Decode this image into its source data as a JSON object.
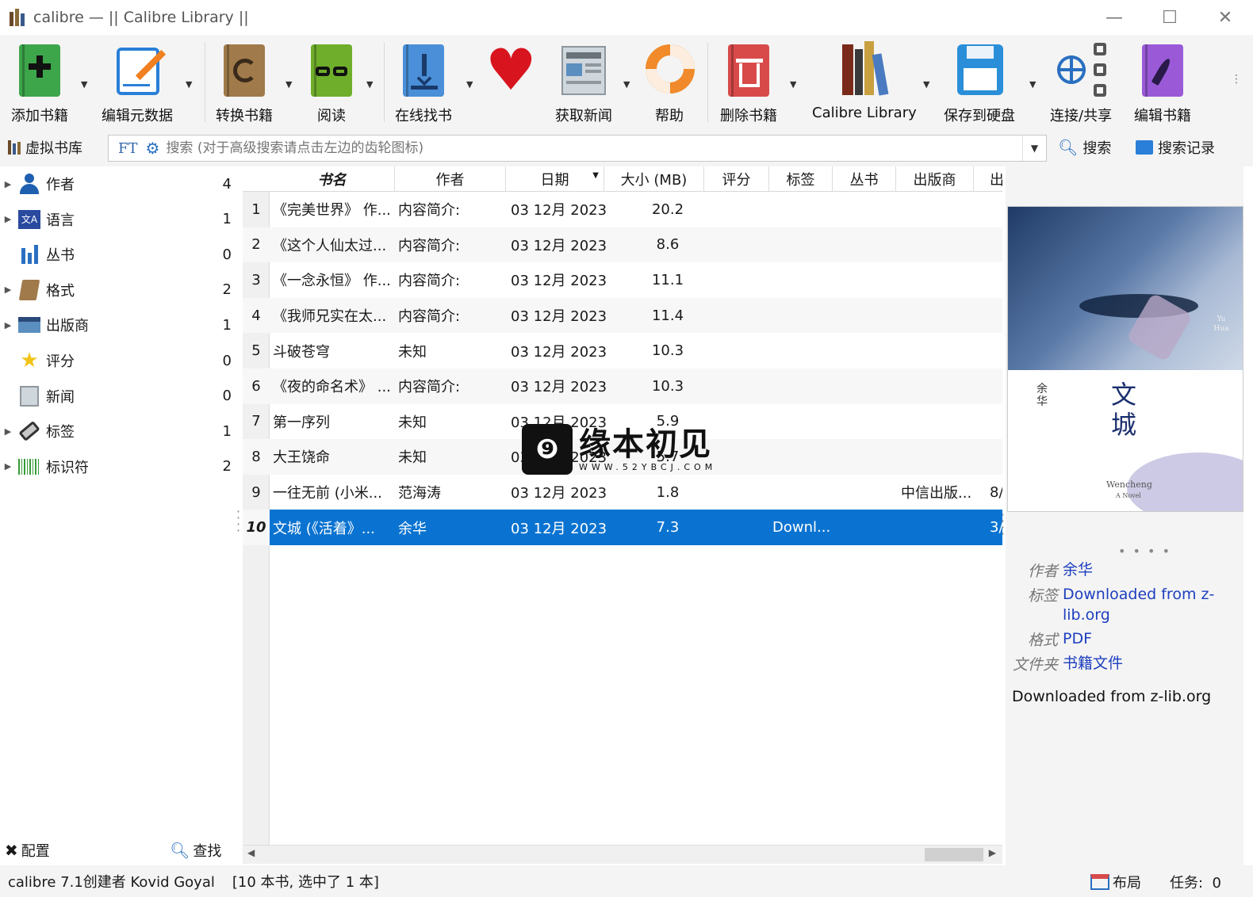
{
  "window": {
    "title": "calibre — || Calibre Library ||",
    "controls": [
      "—",
      "☐",
      "✕"
    ]
  },
  "toolbar": {
    "items": [
      {
        "label": "添加书籍",
        "icon": "add-book-icon"
      },
      {
        "label": "编辑元数据",
        "icon": "edit-metadata-icon"
      },
      {
        "label": "转换书籍",
        "icon": "convert-book-icon"
      },
      {
        "label": "阅读",
        "icon": "read-book-icon"
      },
      {
        "label": "在线找书",
        "icon": "get-books-icon"
      },
      {
        "label": "",
        "icon": "donate-heart-icon"
      },
      {
        "label": "获取新闻",
        "icon": "fetch-news-icon"
      },
      {
        "label": "帮助",
        "icon": "help-lifebuoy-icon"
      },
      {
        "label": "删除书籍",
        "icon": "remove-book-icon"
      },
      {
        "label": "Calibre Library",
        "icon": "library-icon"
      },
      {
        "label": "保存到硬盘",
        "icon": "save-disk-icon"
      },
      {
        "label": "连接/共享",
        "icon": "connect-share-icon"
      },
      {
        "label": "编辑书籍",
        "icon": "edit-book-icon"
      }
    ]
  },
  "searchbar": {
    "virtual_library": "虚拟书库",
    "placeholder": "搜索 (对于高级搜索请点击左边的齿轮图标)",
    "ft": "FT",
    "search_button": "搜索",
    "saved_search_button": "搜索记录"
  },
  "tag_browser": {
    "items": [
      {
        "label": "作者",
        "count": "4",
        "expandable": true
      },
      {
        "label": "语言",
        "count": "1",
        "expandable": true
      },
      {
        "label": "丛书",
        "count": "0",
        "expandable": false
      },
      {
        "label": "格式",
        "count": "2",
        "expandable": true
      },
      {
        "label": "出版商",
        "count": "1",
        "expandable": true
      },
      {
        "label": "评分",
        "count": "0",
        "expandable": false
      },
      {
        "label": "新闻",
        "count": "0",
        "expandable": false
      },
      {
        "label": "标签",
        "count": "1",
        "expandable": true
      },
      {
        "label": "标识符",
        "count": "2",
        "expandable": true
      }
    ],
    "configure": "配置",
    "find": "查找"
  },
  "book_table": {
    "columns": [
      "书名",
      "作者",
      "日期",
      "大小 (MB)",
      "评分",
      "标签",
      "丛书",
      "出版商",
      "出"
    ],
    "rows": [
      {
        "num": "1",
        "title": "《完美世界》 作...",
        "author": "内容简介:",
        "date": "03 12月 2023",
        "size": "20.2",
        "tags": "",
        "publisher": "",
        "extra": ""
      },
      {
        "num": "2",
        "title": "《这个人仙太过...",
        "author": "内容简介:",
        "date": "03 12月 2023",
        "size": "8.6",
        "tags": "",
        "publisher": "",
        "extra": ""
      },
      {
        "num": "3",
        "title": "《一念永恒》 作...",
        "author": "内容简介:",
        "date": "03 12月 2023",
        "size": "11.1",
        "tags": "",
        "publisher": "",
        "extra": ""
      },
      {
        "num": "4",
        "title": "《我师兄实在太...",
        "author": "内容简介:",
        "date": "03 12月 2023",
        "size": "11.4",
        "tags": "",
        "publisher": "",
        "extra": ""
      },
      {
        "num": "5",
        "title": "斗破苍穹",
        "author": "未知",
        "date": "03 12月 2023",
        "size": "10.3",
        "tags": "",
        "publisher": "",
        "extra": ""
      },
      {
        "num": "6",
        "title": "《夜的命名术》 ...",
        "author": "内容简介:",
        "date": "03 12月 2023",
        "size": "10.3",
        "tags": "",
        "publisher": "",
        "extra": ""
      },
      {
        "num": "7",
        "title": "第一序列",
        "author": "未知",
        "date": "03 12月 2023",
        "size": "5.9",
        "tags": "",
        "publisher": "",
        "extra": ""
      },
      {
        "num": "8",
        "title": "大王饶命",
        "author": "未知",
        "date": "03 12月 2023",
        "size": "5.7",
        "tags": "",
        "publisher": "",
        "extra": ""
      },
      {
        "num": "9",
        "title": "一往无前 (小米...",
        "author": "范海涛",
        "date": "03 12月 2023",
        "size": "1.8",
        "tags": "",
        "publisher": "中信出版...",
        "extra": "8/"
      },
      {
        "num": "10",
        "title": "文城 (《活着》...",
        "author": "余华",
        "date": "03 12月 2023",
        "size": "7.3",
        "tags": "Downl...",
        "publisher": "",
        "extra": "3/"
      }
    ],
    "selected_row": 9
  },
  "details": {
    "cover": {
      "title": "文城",
      "author": "余华",
      "en_title": "Wencheng",
      "en_sub": "A Novel",
      "en_author": "Yu Hua"
    },
    "fields": [
      {
        "key": "作者",
        "value": "余华"
      },
      {
        "key": "标签",
        "value": "Downloaded from z-lib.org"
      },
      {
        "key": "格式",
        "value": "PDF"
      },
      {
        "key": "文件夹",
        "value": "书籍文件"
      }
    ],
    "comment": "Downloaded from z-lib.org"
  },
  "statusbar": {
    "left": "calibre 7.1创建者 Kovid Goyal",
    "books": "[10 本书, 选中了 1 本]",
    "layout": "布局",
    "jobs": "任务:  0"
  },
  "watermark": {
    "main": "缘本初见",
    "sub": "WWW.52YBCJ.COM"
  }
}
